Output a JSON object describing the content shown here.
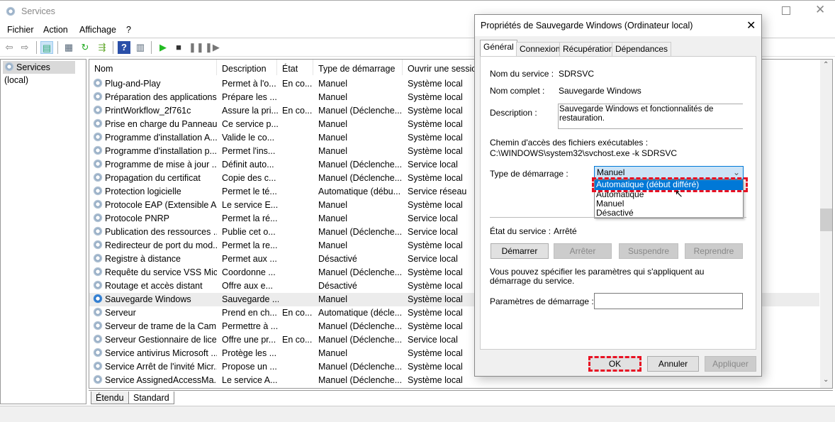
{
  "window": {
    "title": "Services",
    "icon": "gear-icon"
  },
  "menu": [
    "Fichier",
    "Action",
    "Affichage",
    "?"
  ],
  "toolbar": {
    "icons": [
      "back-arrow-icon",
      "forward-arrow-icon",
      "console-tree-icon",
      "properties-icon",
      "refresh-icon",
      "export-icon",
      "help-icon",
      "view-icon",
      "play-icon",
      "stop-icon",
      "pause-icon",
      "resume-icon"
    ]
  },
  "left_pane": {
    "item": "Services (local)"
  },
  "list": {
    "columns": [
      "Nom",
      "Description",
      "État",
      "Type de démarrage",
      "Ouvrir une session"
    ],
    "rows": [
      [
        "Plug-and-Play",
        "Permet à l'o...",
        "En co...",
        "Manuel",
        "Système local"
      ],
      [
        "Préparation des applications",
        "Prépare les ...",
        "",
        "Manuel",
        "Système local"
      ],
      [
        "PrintWorkflow_2f761c",
        "Assure la pri...",
        "En co...",
        "Manuel (Déclenche...",
        "Système local"
      ],
      [
        "Prise en charge du Panneau...",
        "Ce service p...",
        "",
        "Manuel",
        "Système local"
      ],
      [
        "Programme d'installation A...",
        "Valide le co...",
        "",
        "Manuel",
        "Système local"
      ],
      [
        "Programme d'installation p...",
        "Permet l'ins...",
        "",
        "Manuel",
        "Système local"
      ],
      [
        "Programme de mise à jour ...",
        "Définit auto...",
        "",
        "Manuel (Déclenche...",
        "Service local"
      ],
      [
        "Propagation du certificat",
        "Copie des c...",
        "",
        "Manuel (Déclenche...",
        "Système local"
      ],
      [
        "Protection logicielle",
        "Permet le té...",
        "",
        "Automatique (débu...",
        "Service réseau"
      ],
      [
        "Protocole EAP (Extensible A...",
        "Le service E...",
        "",
        "Manuel",
        "Système local"
      ],
      [
        "Protocole PNRP",
        "Permet la ré...",
        "",
        "Manuel",
        "Service local"
      ],
      [
        "Publication des ressources ...",
        "Publie cet o...",
        "",
        "Manuel (Déclenche...",
        "Service local"
      ],
      [
        "Redirecteur de port du mod...",
        "Permet la re...",
        "",
        "Manuel",
        "Système local"
      ],
      [
        "Registre à distance",
        "Permet aux ...",
        "",
        "Désactivé",
        "Service local"
      ],
      [
        "Requête du service VSS Mic...",
        "Coordonne ...",
        "",
        "Manuel (Déclenche...",
        "Système local"
      ],
      [
        "Routage et accès distant",
        "Offre aux e...",
        "",
        "Désactivé",
        "Système local"
      ],
      [
        "Sauvegarde Windows",
        "Sauvegarde ...",
        "",
        "Manuel",
        "Système local"
      ],
      [
        "Serveur",
        "Prend en ch...",
        "En co...",
        "Automatique (décle...",
        "Système local"
      ],
      [
        "Serveur de trame de la Cam...",
        "Permettre à ...",
        "",
        "Manuel (Déclenche...",
        "Système local"
      ],
      [
        "Serveur Gestionnaire de lice...",
        "Offre une pr...",
        "En co...",
        "Manuel (Déclenche...",
        "Service local"
      ],
      [
        "Service antivirus Microsoft ...",
        "Protège les ...",
        "",
        "Manuel",
        "Système local"
      ],
      [
        "Service Arrêt de l'invité Micr...",
        "Propose un ...",
        "",
        "Manuel (Déclenche...",
        "Système local"
      ],
      [
        "Service AssignedAccessMa...",
        "Le service A...",
        "",
        "Manuel (Déclenche...",
        "Système local"
      ]
    ],
    "selected_row": 16
  },
  "bottom_tabs": [
    "Étendu",
    "Standard"
  ],
  "dialog": {
    "title": "Propriétés de Sauvegarde Windows (Ordinateur local)",
    "tabs": [
      "Général",
      "Connexion",
      "Récupération",
      "Dépendances"
    ],
    "service_name_label": "Nom du service :",
    "service_name": "SDRSVC",
    "full_name_label": "Nom complet :",
    "full_name": "Sauvegarde Windows",
    "description_label": "Description :",
    "description": "Sauvegarde Windows et fonctionnalités de restauration.",
    "path_label": "Chemin d'accès des fichiers exécutables :",
    "path": "C:\\WINDOWS\\system32\\svchost.exe -k SDRSVC",
    "startup_label": "Type de démarrage :",
    "startup_value": "Manuel",
    "startup_options": [
      "Automatique (début différé)",
      "Automatique",
      "Manuel",
      "Désactivé"
    ],
    "highlighted_option": 0,
    "status_label": "État du service :",
    "status_value": "Arrêté",
    "buttons": {
      "start": "Démarrer",
      "stop": "Arrêter",
      "pause": "Suspendre",
      "resume": "Reprendre"
    },
    "params_hint": "Vous pouvez spécifier les paramètres qui s'appliquent au démarrage du service.",
    "params_label": "Paramètres de démarrage :",
    "params_value": "",
    "ok": "OK",
    "cancel": "Annuler",
    "apply": "Appliquer"
  },
  "colors": {
    "selection": "#0078d7",
    "highlight_dash": "#e81123"
  }
}
